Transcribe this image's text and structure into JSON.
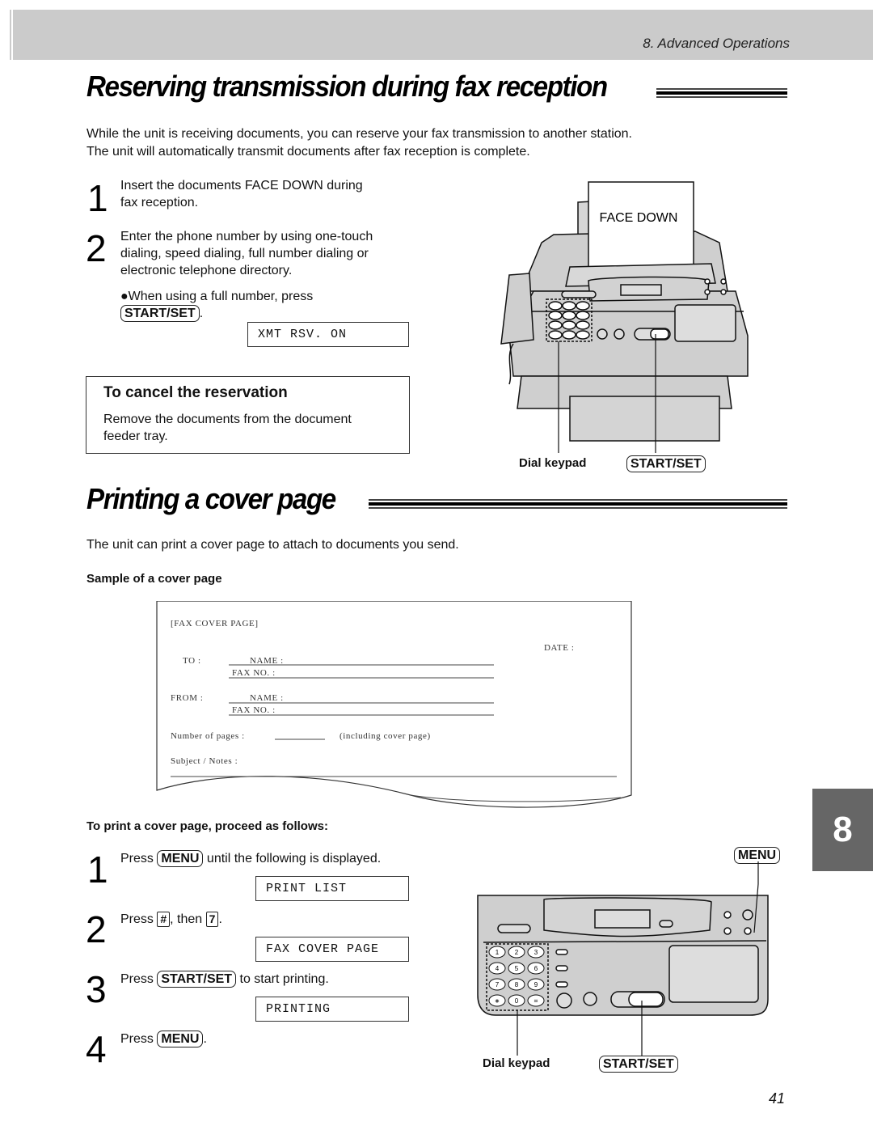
{
  "header": {
    "chapter": "8.  Advanced Operations"
  },
  "section1": {
    "title": "Reserving transmission during fax reception",
    "intro_line1": "While the unit is receiving documents, you can reserve your fax transmission to another station.",
    "intro_line2": "The unit will automatically transmit documents after fax reception is complete.",
    "steps": [
      {
        "num": "1",
        "line1": "Insert the documents FACE DOWN during",
        "line2": "fax reception."
      },
      {
        "num": "2",
        "line1": "Enter the phone number by using one-touch",
        "line2": "dialing, speed dialing, full number dialing or",
        "line3": "electronic telephone directory."
      }
    ],
    "bullet": "●When using a full number, press",
    "bullet_key": "START/SET",
    "lcd": "XMT RSV. ON",
    "cancel": {
      "title": "To cancel the reservation",
      "line1": "Remove the documents from the document",
      "line2": "feeder tray."
    },
    "figure": {
      "paper_label": "FACE DOWN",
      "callout_keypad": "Dial keypad",
      "callout_start": "START/SET"
    }
  },
  "section2": {
    "title": "Printing a cover page",
    "intro": "The unit can print a cover page to attach to documents you send.",
    "sample_label": "Sample of a cover page",
    "sample": {
      "heading": "[FAX COVER PAGE]",
      "date": "DATE :",
      "to": "TO :",
      "from": "FROM :",
      "name": "NAME :",
      "faxno": "FAX NO. :",
      "pages": "Number of pages :",
      "including": "(including cover page)",
      "subject": "Subject / Notes :"
    },
    "proceed_label": "To print a cover page, proceed as follows:",
    "steps": [
      {
        "num": "1",
        "pre": "Press",
        "key": "MENU",
        "post": "until the following is displayed.",
        "lcd": "PRINT LIST"
      },
      {
        "num": "2",
        "pre": "Press",
        "key": "#",
        "mid": ", then",
        "key2": "7",
        "post": ".",
        "lcd": "FAX COVER PAGE"
      },
      {
        "num": "3",
        "pre": "Press",
        "key": "START/SET",
        "post": "to start printing.",
        "lcd": "PRINTING"
      },
      {
        "num": "4",
        "pre": "Press",
        "key": "MENU",
        "post": "."
      }
    ],
    "figure": {
      "callout_menu": "MENU",
      "callout_keypad": "Dial keypad",
      "callout_start": "START/SET",
      "keypad_keys": [
        "1",
        "2",
        "3",
        "4",
        "5",
        "6",
        "7",
        "8",
        "9",
        "∗",
        "0",
        "⌗"
      ]
    }
  },
  "tab": "8",
  "page_number": "41"
}
